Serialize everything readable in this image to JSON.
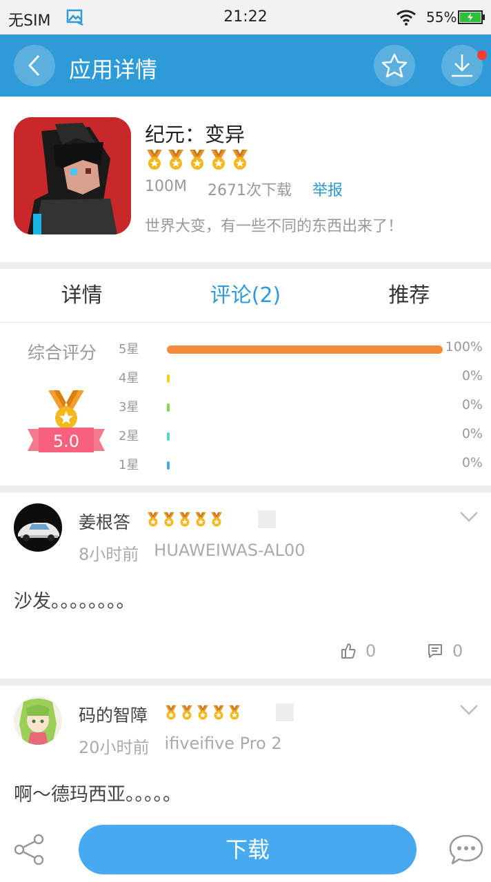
{
  "status_bar": {
    "carrier": "无SIM",
    "time": "21:22",
    "battery": "55%"
  },
  "header": {
    "title": "应用详情",
    "color": "#2e9ad8"
  },
  "app": {
    "name": "纪元：变异",
    "medal_count": 5,
    "size": "100M",
    "downloads": "2671次下载",
    "report": "举报",
    "description": "世界大变，有一些不同的东西出来了！"
  },
  "tabs": [
    {
      "label": "详情",
      "active": false
    },
    {
      "label": "评论(2)",
      "active": true
    },
    {
      "label": "推荐",
      "active": false
    }
  ],
  "rating": {
    "label": "综合评分",
    "score": "5.0",
    "rows": [
      {
        "star": "5星",
        "pct": "100%",
        "fraction": 1.0,
        "color": "#f28c3a"
      },
      {
        "star": "4星",
        "pct": "0%",
        "fraction": 0,
        "color": "#f5d020"
      },
      {
        "star": "3星",
        "pct": "0%",
        "fraction": 0,
        "color": "#7ed957"
      },
      {
        "star": "2星",
        "pct": "0%",
        "fraction": 0,
        "color": "#56d6c4"
      },
      {
        "star": "1星",
        "pct": "0%",
        "fraction": 0,
        "color": "#4aa8e0"
      }
    ]
  },
  "comments": [
    {
      "user": "姜根答",
      "time": "8小时前",
      "device": "HUAWEIWAS-AL00",
      "text": "沙发。。。。。。。。",
      "likes": "0",
      "replies": "0"
    },
    {
      "user": "码的智障",
      "time": "20小时前",
      "device": "ifiveifive Pro 2",
      "text": "啊～德玛西亚。。。。。"
    }
  ],
  "bottom": {
    "download": "下载"
  }
}
